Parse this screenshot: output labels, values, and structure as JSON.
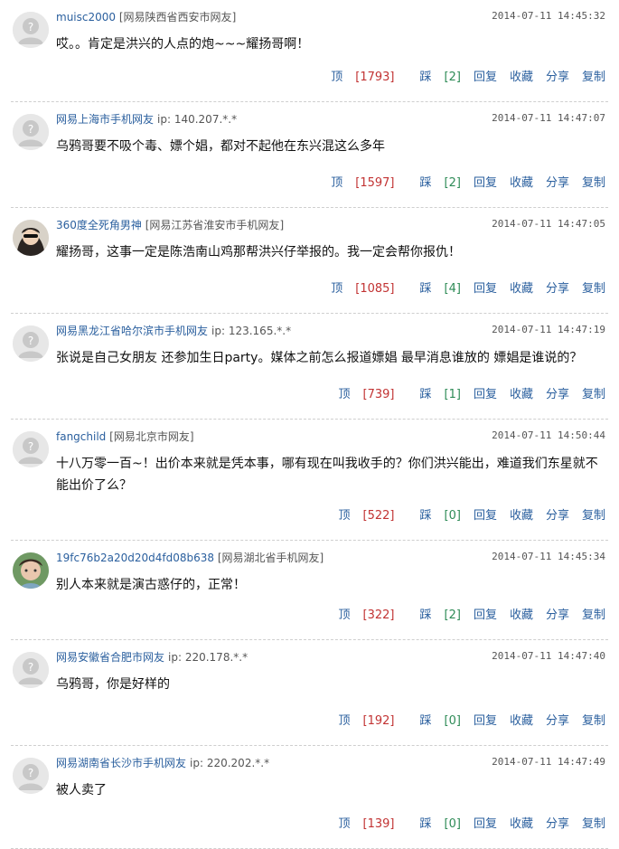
{
  "actions": {
    "reply": "回复",
    "favorite": "收藏",
    "share": "分享",
    "copy": "复制",
    "up": "顶",
    "down": "踩"
  },
  "comments": [
    {
      "user": "muisc2000",
      "location": "网易陕西省西安市网友",
      "ip": "",
      "time": "2014-07-11 14:45:32",
      "text": "哎。。肯定是洪兴的人点的炮~~~耀扬哥啊！",
      "up": "[1793]",
      "down": "[2]",
      "avatar": "default"
    },
    {
      "user": "网易上海市手机网友",
      "location": "",
      "ip": "ip: 140.207.*.*",
      "time": "2014-07-11 14:47:07",
      "text": "乌鸦哥要不吸个毒、嫖个娼，都对不起他在东兴混这么多年",
      "up": "[1597]",
      "down": "[2]",
      "avatar": "default"
    },
    {
      "user": "360度全死角男神",
      "location": "网易江苏省淮安市手机网友",
      "ip": "",
      "time": "2014-07-11 14:47:05",
      "text": "耀扬哥，这事一定是陈浩南山鸡那帮洪兴仔举报的。我一定会帮你报仇！",
      "up": "[1085]",
      "down": "[4]",
      "avatar": "photo-sunglasses"
    },
    {
      "user": "网易黑龙江省哈尔滨市手机网友",
      "location": "",
      "ip": "ip: 123.165.*.*",
      "time": "2014-07-11 14:47:19",
      "text": "张说是自己女朋友 还参加生日party。媒体之前怎么报道嫖娼 最早消息谁放的 嫖娼是谁说的？",
      "up": "[739]",
      "down": "[1]",
      "avatar": "default"
    },
    {
      "user": "fangchild",
      "location": "网易北京市网友",
      "ip": "",
      "time": "2014-07-11 14:50:44",
      "text": "十八万零一百~！出价本来就是凭本事，哪有现在叫我收手的？你们洪兴能出，难道我们东星就不能出价了么？",
      "up": "[522]",
      "down": "[0]",
      "avatar": "default"
    },
    {
      "user": "19fc76b2a20d20d4fd08b638",
      "location": "网易湖北省手机网友",
      "ip": "",
      "time": "2014-07-11 14:45:34",
      "text": "别人本来就是演古惑仔的，正常！",
      "up": "[322]",
      "down": "[2]",
      "avatar": "photo-green"
    },
    {
      "user": "网易安徽省合肥市网友",
      "location": "",
      "ip": "ip: 220.178.*.*",
      "time": "2014-07-11 14:47:40",
      "text": "乌鸦哥，你是好样的",
      "up": "[192]",
      "down": "[0]",
      "avatar": "default"
    },
    {
      "user": "网易湖南省长沙市手机网友",
      "location": "",
      "ip": "ip: 220.202.*.*",
      "time": "2014-07-11 14:47:49",
      "text": "被人卖了",
      "up": "[139]",
      "down": "[0]",
      "avatar": "default"
    }
  ]
}
